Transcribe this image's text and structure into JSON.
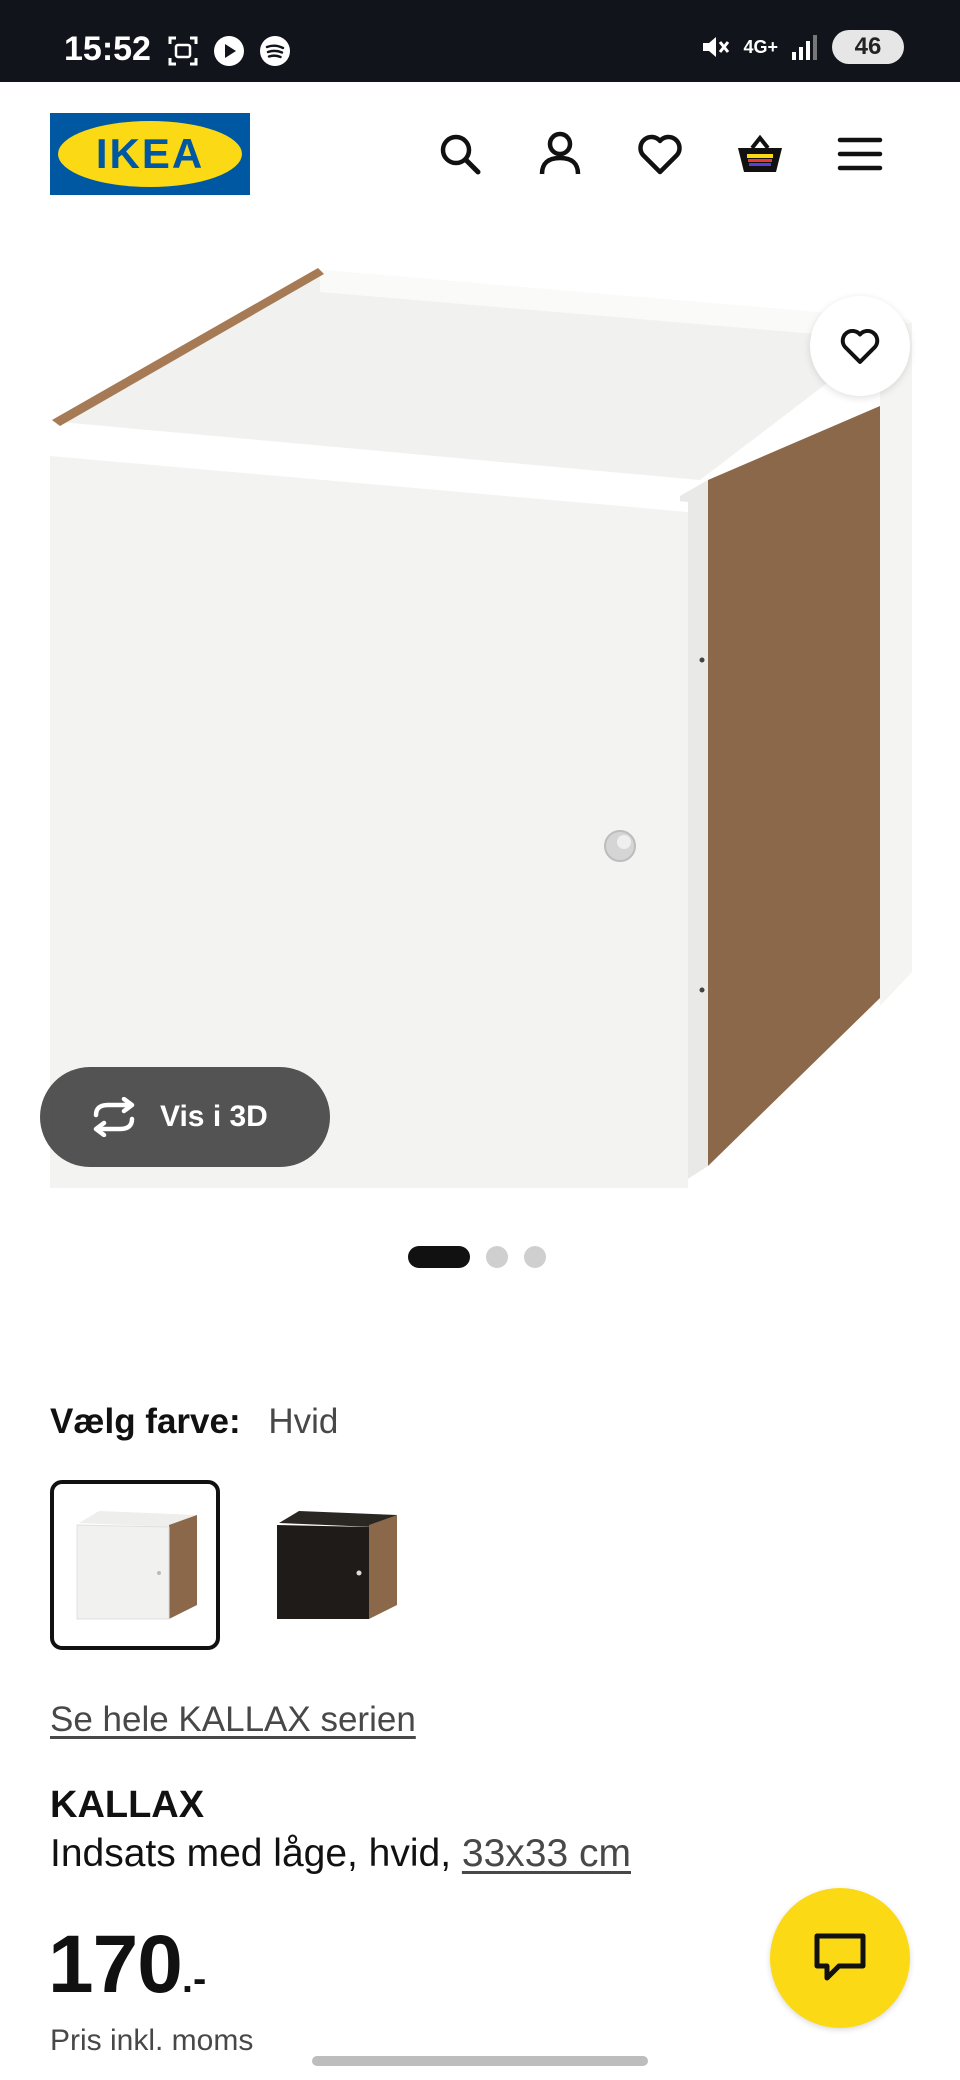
{
  "status_bar": {
    "time": "15:52",
    "network": "4G+",
    "battery": "46",
    "left_icons": [
      "screenshot-icon",
      "media-play-icon",
      "spotify-icon"
    ],
    "right_icons": [
      "mute-icon",
      "signal-icon",
      "battery-icon"
    ]
  },
  "header": {
    "logo_text": "IKEA",
    "nav_icons": [
      "search-icon",
      "account-icon",
      "wishlist-heart-icon",
      "cart-basket-icon",
      "menu-icon"
    ]
  },
  "gallery": {
    "view_3d_label": "Vis i 3D",
    "slide_count": 3,
    "active_slide": 1
  },
  "color_select": {
    "label": "Vælg farve:",
    "selected_value": "Hvid",
    "options": [
      "Hvid",
      "Sort"
    ]
  },
  "series_link": "Se hele KALLAX serien",
  "product": {
    "name": "KALLAX",
    "description_prefix": "Indsats med låge, hvid, ",
    "size": "33x33 cm"
  },
  "price": {
    "integer": "170",
    "suffix": ".-",
    "note": "Pris inkl. moms"
  },
  "colors": {
    "ikea_blue": "#0058a3",
    "ikea_yellow": "#fbd914",
    "status_bar_bg": "#11141a"
  }
}
